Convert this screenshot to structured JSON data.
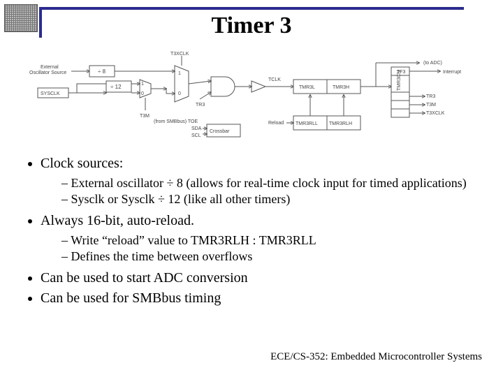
{
  "title": "Timer 3",
  "footer": "ECE/CS-352: Embedded Microcontroller Systems",
  "bullets": {
    "b1": "Clock sources:",
    "b1a": "External oscillator ÷ 8 (allows for real-time clock input for timed applications)",
    "b1b": "Sysclk or Sysclk ÷ 12 (like all other timers)",
    "b2": "Always 16-bit, auto-reload.",
    "b2a": "Write “reload” value to TMR3RLH : TMR3RLL",
    "b2b": "Defines the time between overflows",
    "b3": "Can be used to start ADC conversion",
    "b4": "Can be used for SMBbus timing"
  },
  "diagram": {
    "ext_osc": "External\nOscillator Source",
    "sysclk": "SYSCLK",
    "div8": "÷ 8",
    "div12": "÷ 12",
    "t3m": "T3M",
    "t3xclk_top": "T3XCLK",
    "mux_1": "1",
    "mux_0": "0",
    "tr3": "TR3",
    "tclk": "TCLK",
    "tmr3l": "TMR3L",
    "tmr3h": "TMR3H",
    "tmr3rll": "TMR3RLL",
    "tmr3rlh": "TMR3RLH",
    "reload": "Reload",
    "crossbar_note": "(from SMBbus) TOE",
    "crossbar_sda": "SDA",
    "crossbar_scl": "SCL",
    "crossbar": "Crossbar",
    "to_adc": "(to ADC)",
    "interrupt": "Interrupt",
    "ctrl_tf3": "TF3",
    "ctrl_tr3": "TR3",
    "ctrl_t3m": "T3M",
    "ctrl_t3xclk": "T3XCLK",
    "ctrl_label": "TMR3CN"
  }
}
